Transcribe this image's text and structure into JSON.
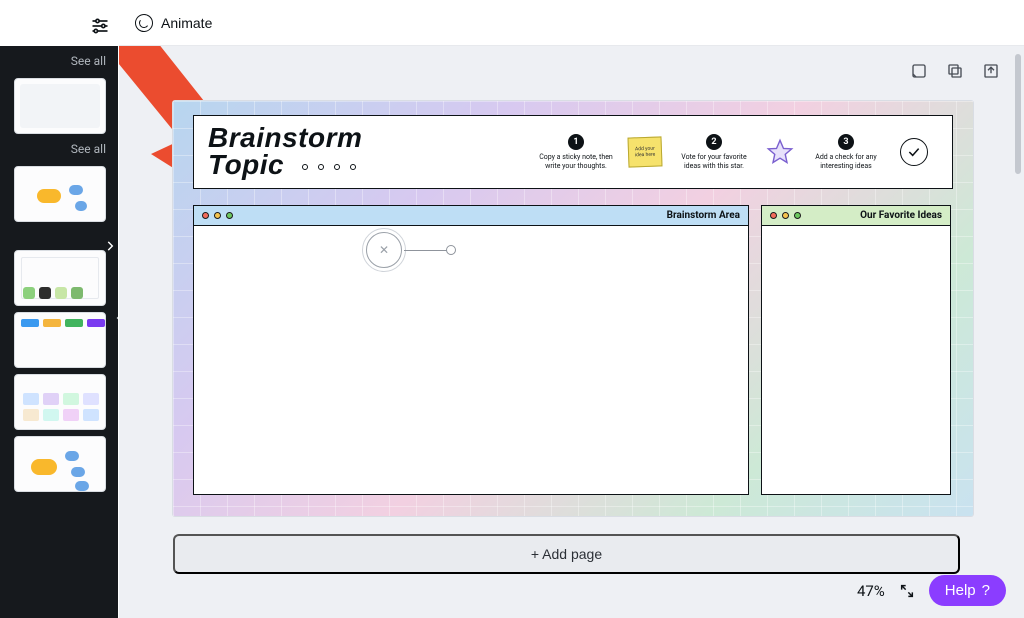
{
  "toolbar": {
    "animate_label": "Animate"
  },
  "sidebar": {
    "see_all_1": "See all",
    "see_all_2": "See all"
  },
  "slide": {
    "title_line1": "Brainstorm",
    "title_line2": "Topic",
    "step1_text": "Copy a sticky note, then write your thoughts.",
    "sticky_text": "Add your idea here",
    "step2_text": "Vote for your favorite ideas with this star.",
    "step3_text": "Add a check for any interesting ideas",
    "brainstorm_area": "Brainstorm Area",
    "fav_ideas": "Our Favorite Ideas"
  },
  "add_page_label": "+ Add page",
  "footer": {
    "zoom_pct": "47%",
    "help_label": "Help"
  }
}
